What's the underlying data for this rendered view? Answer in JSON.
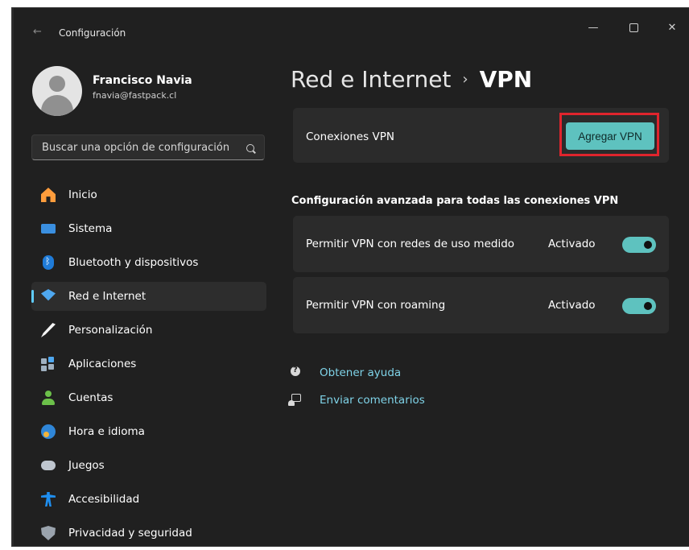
{
  "window": {
    "title": "Configuración",
    "back_icon": "arrow-left-icon",
    "controls": {
      "minimize": "—",
      "close": "✕"
    }
  },
  "profile": {
    "name": "Francisco Navia",
    "email": "fnavia@fastpack.cl"
  },
  "search": {
    "placeholder": "Buscar una opción de configuración"
  },
  "sidebar": {
    "items": [
      {
        "label": "Inicio",
        "icon": "home-icon"
      },
      {
        "label": "Sistema",
        "icon": "monitor-icon"
      },
      {
        "label": "Bluetooth y dispositivos",
        "icon": "bluetooth-icon"
      },
      {
        "label": "Red e Internet",
        "icon": "wifi-icon",
        "active": true
      },
      {
        "label": "Personalización",
        "icon": "brush-icon"
      },
      {
        "label": "Aplicaciones",
        "icon": "apps-icon"
      },
      {
        "label": "Cuentas",
        "icon": "person-icon"
      },
      {
        "label": "Hora e idioma",
        "icon": "globe-clock-icon"
      },
      {
        "label": "Juegos",
        "icon": "gamepad-icon"
      },
      {
        "label": "Accesibilidad",
        "icon": "accessibility-icon"
      },
      {
        "label": "Privacidad y seguridad",
        "icon": "shield-icon"
      }
    ]
  },
  "main": {
    "breadcrumb": {
      "parent": "Red e Internet",
      "separator": "›",
      "current": "VPN"
    },
    "vpn_connections": {
      "label": "Conexiones VPN",
      "button": "Agregar VPN"
    },
    "advanced_heading": "Configuración avanzada para todas las conexiones VPN",
    "settings": [
      {
        "label": "Permitir VPN con redes de uso medido",
        "state": "Activado",
        "on": true
      },
      {
        "label": "Permitir VPN con roaming",
        "state": "Activado",
        "on": true
      }
    ],
    "links": [
      {
        "label": "Obtener ayuda",
        "icon": "help-icon"
      },
      {
        "label": "Enviar comentarios",
        "icon": "feedback-icon"
      }
    ]
  },
  "colors": {
    "background": "#202020",
    "card": "#2b2b2b",
    "accent": "#5ec2bf",
    "link": "#7fd3e8",
    "highlight": "#e0242d"
  }
}
